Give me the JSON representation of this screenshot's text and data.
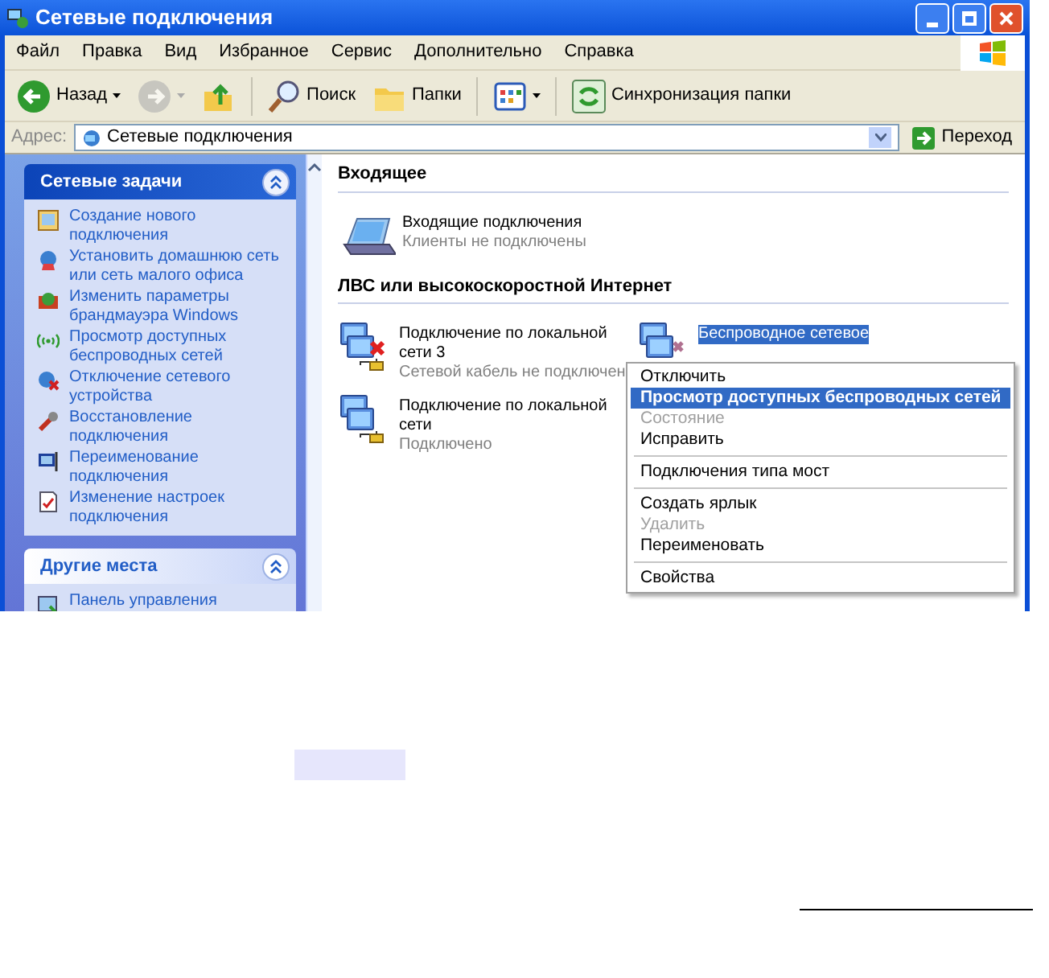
{
  "window": {
    "title": "Сетевые подключения"
  },
  "menu_bar": [
    "Файл",
    "Правка",
    "Вид",
    "Избранное",
    "Сервис",
    "Дополнительно",
    "Справка"
  ],
  "toolbar": [
    {
      "kind": "back",
      "label": "Назад",
      "disabled": false
    },
    {
      "kind": "forward",
      "disabled": true
    },
    {
      "kind": "up",
      "disabled": false
    },
    {
      "kind": "search",
      "label": "Поиск",
      "disabled": false
    },
    {
      "kind": "folders",
      "label": "Папки",
      "disabled": false
    },
    {
      "kind": "views",
      "disabled": false
    },
    {
      "kind": "sync",
      "label": "Синхронизация папки",
      "disabled": false
    }
  ],
  "address_bar": {
    "label": "Адрес:",
    "value": "Сетевые подключения",
    "go": "Переход"
  },
  "sidebar": {
    "panels": [
      {
        "title": "Сетевые задачи",
        "kind": "primary",
        "expanded": true,
        "items": [
          {
            "label": "Создание нового подключения"
          },
          {
            "label": "Установить домашнюю сеть или сеть малого офиса"
          },
          {
            "label": "Изменить параметры брандмауэра Windows"
          },
          {
            "label": "Просмотр доступных беспроводных сетей"
          },
          {
            "label": "Отключение сетевого устройства"
          },
          {
            "label": "Восстановление подключения"
          },
          {
            "label": "Переименование подключения"
          },
          {
            "label": "Изменение настроек подключения"
          }
        ]
      },
      {
        "title": "Другие места",
        "kind": "secondary",
        "expanded": true,
        "items": [
          {
            "label": "Панель управления"
          }
        ]
      }
    ]
  },
  "groups": [
    {
      "title": "Входящее",
      "items": [
        {
          "kind": "incoming",
          "name": "Входящие подключения",
          "status": "Клиенты не подключены",
          "selected": false
        }
      ]
    },
    {
      "title": "ЛВС или высокоскоростной Интернет",
      "items": [
        {
          "kind": "lan",
          "name": "Подключение по локальной сети 3",
          "status": "Сетевой кабель не подключен",
          "disconnected": true,
          "selected": false
        },
        {
          "kind": "wireless",
          "name": "Беспроводное сетевое",
          "disconnected": true,
          "selected": true
        },
        {
          "kind": "lan",
          "name": "Подключение по локальной сети",
          "status": "Подключено",
          "disconnected": false,
          "selected": false
        }
      ]
    }
  ],
  "context_menu": {
    "sections": [
      [
        {
          "label": "Отключить",
          "default": false,
          "selected": false,
          "disabled": false
        },
        {
          "label": "Просмотр доступных беспроводных сетей",
          "default": true,
          "selected": true,
          "disabled": false
        },
        {
          "label": "Состояние",
          "default": false,
          "selected": false,
          "disabled": true
        },
        {
          "label": "Исправить",
          "default": false,
          "selected": false,
          "disabled": false
        }
      ],
      [
        {
          "label": "Подключения типа мост",
          "default": false,
          "selected": false,
          "disabled": false
        }
      ],
      [
        {
          "label": "Создать ярлык",
          "default": false,
          "selected": false,
          "disabled": false
        },
        {
          "label": "Удалить",
          "default": false,
          "selected": false,
          "disabled": true
        },
        {
          "label": "Переименовать",
          "default": false,
          "selected": false,
          "disabled": false
        }
      ],
      [
        {
          "label": "Свойства",
          "default": false,
          "selected": false,
          "disabled": false
        }
      ]
    ]
  }
}
